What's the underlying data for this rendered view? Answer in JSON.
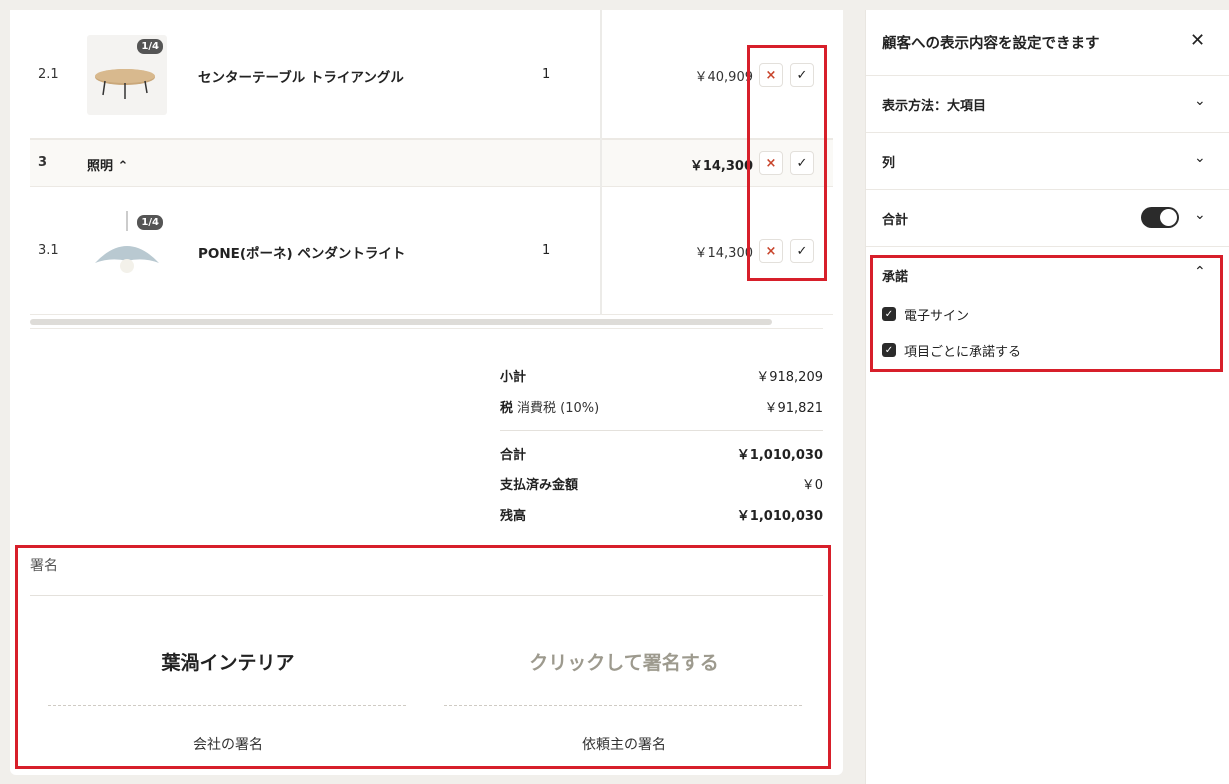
{
  "items": [
    {
      "no": "2.1",
      "name": "センターテーブル トライアングル",
      "qty": "1",
      "price": "￥40,909",
      "badge": "1/4"
    },
    {
      "no": "3.1",
      "name": "PONE(ポーネ) ペンダントライト",
      "qty": "1",
      "price": "￥14,300",
      "badge": "1/4"
    }
  ],
  "category": {
    "no": "3",
    "name": "照明",
    "price": "￥14,300"
  },
  "totals": {
    "subtotal_label": "小計",
    "subtotal": "￥918,209",
    "tax_label": "税",
    "tax_sub": "消費税 (10%)",
    "tax": "￥91,821",
    "total_label": "合計",
    "total": "￥1,010,030",
    "paid_label": "支払済み金額",
    "paid": "￥0",
    "balance_label": "残高",
    "balance": "￥1,010,030"
  },
  "signature": {
    "section_label": "署名",
    "company_name": "葉渦インテリア",
    "client_prompt": "クリックして署名する",
    "company_caption": "会社の署名",
    "client_caption": "依頼主の署名"
  },
  "panel": {
    "title": "顧客への表示内容を設定できます",
    "sections": {
      "display": "表示方法：大項目",
      "columns": "列",
      "total": "合計",
      "approval": "承諾"
    },
    "approval_options": [
      "電子サイン",
      "項目ごとに承諾する"
    ]
  },
  "icons": {
    "reject": "×",
    "approve": "✓",
    "close": "✕",
    "chev_down": "⌄",
    "chev_up": "⌃"
  },
  "colors": {
    "highlight": "#d71f2a",
    "reject": "#c8442b",
    "toggle_on": "#2b2b2b"
  }
}
